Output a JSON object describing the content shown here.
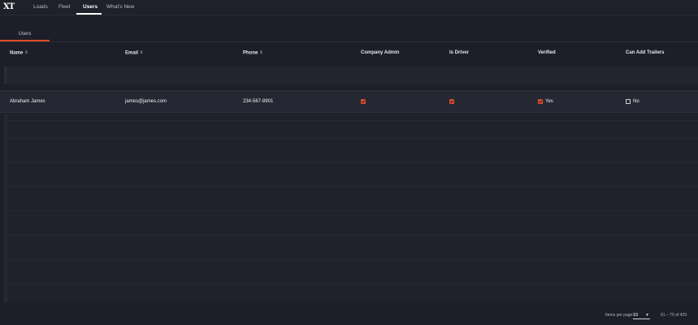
{
  "app": {
    "logo_text": "XT"
  },
  "nav": {
    "tabs": [
      {
        "label": "Loads",
        "active": false
      },
      {
        "label": "Fleet",
        "active": false
      },
      {
        "label": "Users",
        "active": true
      },
      {
        "label": "What's New",
        "active": false
      }
    ]
  },
  "subtabs": [
    {
      "label": "Users",
      "active": true
    }
  ],
  "table": {
    "columns": [
      {
        "label": "Name",
        "sortable": true
      },
      {
        "label": "Email",
        "sortable": true
      },
      {
        "label": "Phone",
        "sortable": true
      },
      {
        "label": "Company Admin",
        "sortable": false
      },
      {
        "label": "Is Driver",
        "sortable": false
      },
      {
        "label": "Verified",
        "sortable": false
      },
      {
        "label": "Can Add Trailers",
        "sortable": false
      }
    ],
    "rows": [
      {
        "name": "Abraham James",
        "email": "james@james.com",
        "phone": "234-567-8901",
        "company_admin": true,
        "is_driver": true,
        "verified": true,
        "verified_label": "Yes",
        "can_add_trailers": false,
        "can_add_trailers_label": "No"
      }
    ]
  },
  "paginator": {
    "items_per_page_label": "Items per page:",
    "page_size": "10",
    "range_label": "61 – 70 of 429"
  },
  "colors": {
    "accent": "#e14a2a",
    "background": "#1c1f27"
  }
}
